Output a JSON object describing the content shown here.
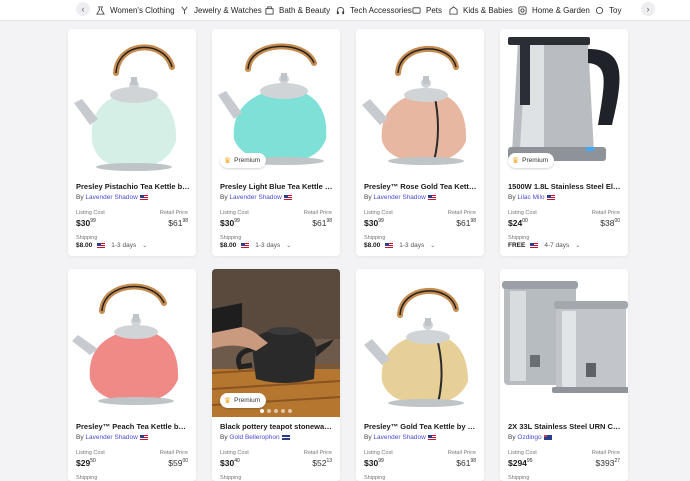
{
  "categories": [
    {
      "label": "Women's Clothing",
      "icon": "dress-icon"
    },
    {
      "label": "Jewelry & Watches",
      "icon": "jewelry-icon"
    },
    {
      "label": "Bath & Beauty",
      "icon": "beauty-icon"
    },
    {
      "label": "Tech Accessories",
      "icon": "headphones-icon"
    },
    {
      "label": "Pets",
      "icon": "pet-icon"
    },
    {
      "label": "Kids & Babies",
      "icon": "kids-icon"
    },
    {
      "label": "Home & Garden",
      "icon": "home-icon"
    },
    {
      "label": "Toy",
      "icon": "toy-icon"
    }
  ],
  "labels": {
    "listing": "Listing Cost",
    "retail": "Retail Price",
    "shipping": "Shipping",
    "premium": "Premium",
    "by": "By"
  },
  "products": [
    {
      "title": "Presley Pistachio Tea Kettle by P...",
      "seller": "Lavender Shadow",
      "listing_main": "$30",
      "listing_cents": "99",
      "retail_main": "$61",
      "retail_cents": "98",
      "ship_price": "$8.00",
      "ship_days": "1-3 days",
      "image": "kettle-mint"
    },
    {
      "title": "Presley Light Blue Tea Kettle by ...",
      "seller": "Lavender Shadow",
      "listing_main": "$30",
      "listing_cents": "99",
      "retail_main": "$61",
      "retail_cents": "98",
      "ship_price": "$8.00",
      "ship_days": "1-3 days",
      "image": "kettle-aqua",
      "premium": true
    },
    {
      "title": "Presley™ Rose Gold Tea Kettle ...",
      "seller": "Lavender Shadow",
      "listing_main": "$30",
      "listing_cents": "99",
      "retail_main": "$61",
      "retail_cents": "98",
      "ship_price": "$8.00",
      "ship_days": "1-3 days",
      "image": "kettle-rose"
    },
    {
      "title": "1500W 1.8L Stainless Steel Elect...",
      "seller": "Lilac Milo",
      "listing_main": "$24",
      "listing_cents": "00",
      "retail_main": "$38",
      "retail_cents": "00",
      "ship_price": "FREE",
      "ship_days": "4-7 days",
      "image": "electric-kettle",
      "premium": true
    },
    {
      "title": "Presley™ Peach Tea Kettle by Pi...",
      "seller": "Lavender Shadow",
      "listing_main": "$29",
      "listing_cents": "50",
      "retail_main": "$59",
      "retail_cents": "00",
      "image": "kettle-peach"
    },
    {
      "title": "Black pottery teapot stoneware ...",
      "seller": "Gold Bellerophon",
      "listing_main": "$30",
      "listing_cents": "40",
      "retail_main": "$52",
      "retail_cents": "13",
      "image": "teapot-black",
      "premium": true
    },
    {
      "title": "Presley™ Gold Tea Kettle by Pin...",
      "seller": "Lavender Shadow",
      "listing_main": "$30",
      "listing_cents": "99",
      "retail_main": "$61",
      "retail_cents": "98",
      "image": "kettle-gold"
    },
    {
      "title": "2X 33L Stainless Steel URN Com...",
      "seller": "Ozdingo",
      "listing_main": "$294",
      "listing_cents": "95",
      "retail_main": "$393",
      "retail_cents": "27",
      "image": "steel-urns"
    }
  ],
  "colors": {
    "mint": "#d6efe6",
    "aqua": "#7fe0d8",
    "rose": "#e8b7a2",
    "peach": "#f08a87",
    "gold": "#e7cf98",
    "link": "#4a4ad8",
    "crown": "#f2a81d"
  }
}
